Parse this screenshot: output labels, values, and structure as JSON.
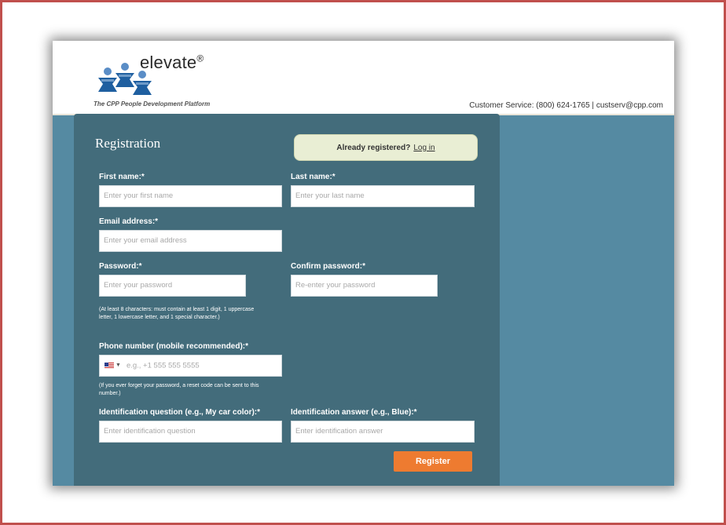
{
  "header": {
    "brand": "elevate",
    "brand_mark": "®",
    "tagline": "The CPP People Development Platform",
    "customer_service": "Customer Service: (800) 624-1765 | custserv@cpp.com"
  },
  "form": {
    "title": "Registration",
    "already_registered": "Already registered?",
    "login_link": "Log in",
    "first_name": {
      "label": "First name:*",
      "placeholder": "Enter your first name"
    },
    "last_name": {
      "label": "Last name:*",
      "placeholder": "Enter your last name"
    },
    "email": {
      "label": "Email address:*",
      "placeholder": "Enter your email address"
    },
    "password": {
      "label": "Password:*",
      "placeholder": "Enter your password"
    },
    "confirm_password": {
      "label": "Confirm password:*",
      "placeholder": "Re-enter your password"
    },
    "password_hint": "(At least 8 characters: must contain at least 1 digit, 1 uppercase letter, 1 lowercase letter, and 1 special character.)",
    "phone": {
      "label": "Phone number (mobile recommended):*",
      "placeholder": "e.g., +1 555 555 5555",
      "country": "US"
    },
    "phone_hint": "(If you ever forget your password, a reset code can be sent to this number.)",
    "id_question": {
      "label": "Identification question (e.g., My car color):*",
      "placeholder": "Enter identification question"
    },
    "id_answer": {
      "label": "Identification answer (e.g., Blue):*",
      "placeholder": "Enter identification answer"
    },
    "register_label": "Register"
  },
  "colors": {
    "frame": "#c0504d",
    "page_bg": "#558aa2",
    "panel": "#436c7b",
    "button": "#ee7b30",
    "login_box": "#e9eed4"
  }
}
